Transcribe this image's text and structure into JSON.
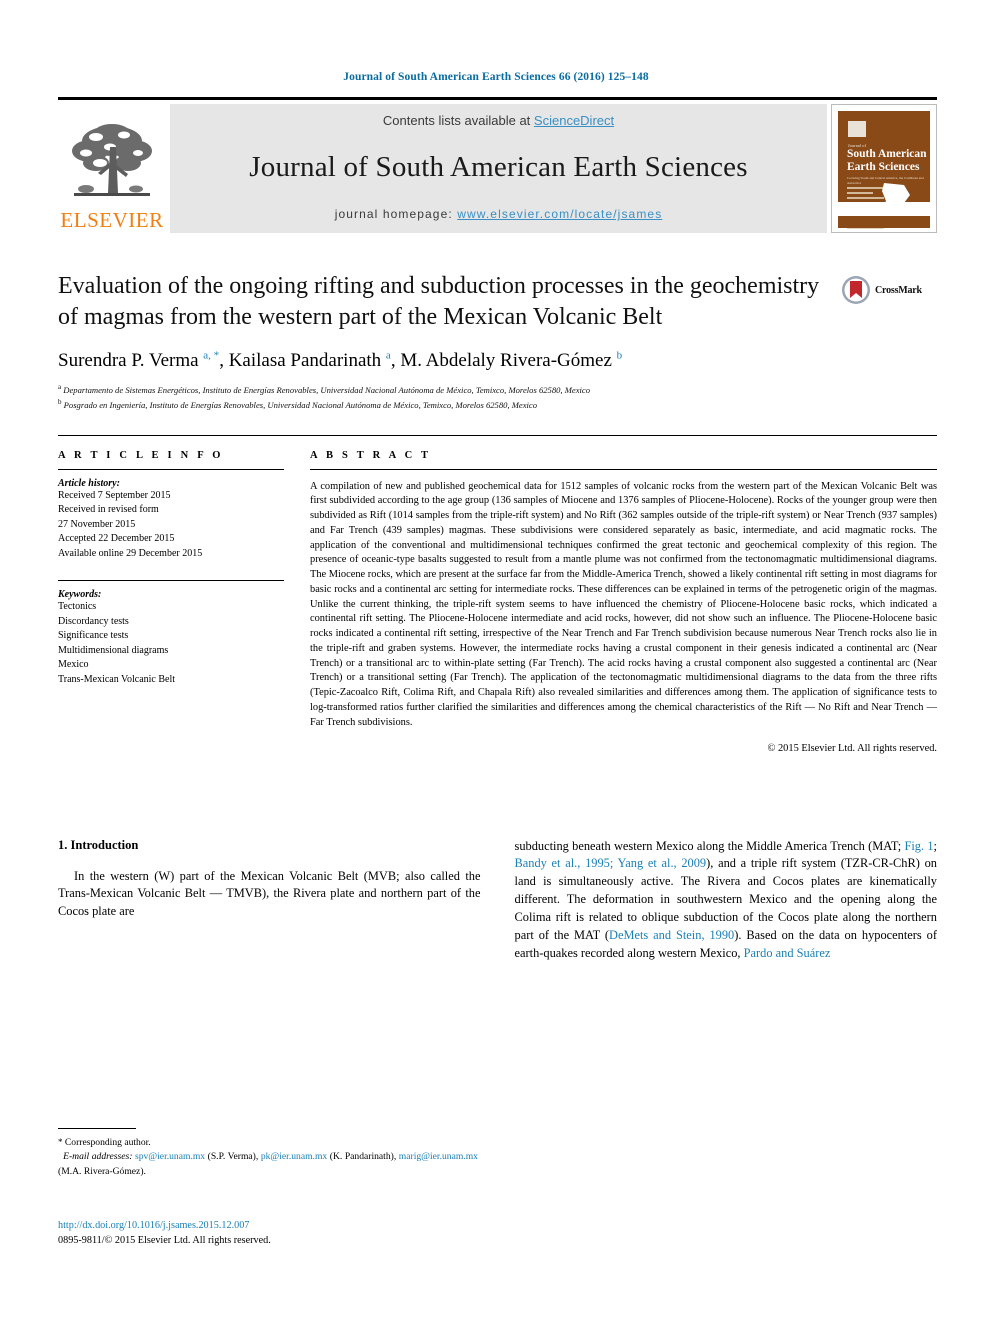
{
  "running_head": "Journal of South American Earth Sciences 66 (2016) 125–148",
  "masthead": {
    "publisher_name": "ELSEVIER",
    "contents_prefix": "Contents lists available at",
    "contents_link": "ScienceDirect",
    "journal_title": "Journal of South American Earth Sciences",
    "homepage_prefix": "journal homepage:",
    "homepage_url": "www.elsevier.com/locate/jsames",
    "cover": {
      "kicker": "Journal of",
      "title_line1": "South American",
      "title_line2": "Earth Sciences",
      "subtitle": "Covering South and Central America, the Caribbean and Antarctica"
    }
  },
  "article": {
    "title": "Evaluation of the ongoing rifting and subduction processes in the geochemistry of magmas from the western part of the Mexican Volcanic Belt",
    "authors_html": "Surendra P. Verma <sup>a, *</sup>, Kailasa Pandarinath <sup>a</sup>, M. Abdelaly Rivera-Gómez <sup>b</sup>",
    "affiliation_a": "Departamento de Sistemas Energéticos, Instituto de Energías Renovables, Universidad Nacional Autónoma de México, Temixco, Morelos 62580, Mexico",
    "affiliation_b": "Posgrado en Ingeniería, Instituto de Energías Renovables, Universidad Nacional Autónoma de México, Temixco, Morelos 62580, Mexico",
    "crossmark_label": "CrossMark"
  },
  "article_info": {
    "heading": "A R T I C L E   I N F O",
    "history_label": "Article history:",
    "history": [
      "Received 7 September 2015",
      "Received in revised form",
      "27 November 2015",
      "Accepted 22 December 2015",
      "Available online 29 December 2015"
    ],
    "keywords_label": "Keywords:",
    "keywords": [
      "Tectonics",
      "Discordancy tests",
      "Significance tests",
      "Multidimensional diagrams",
      "Mexico",
      "Trans-Mexican Volcanic Belt"
    ]
  },
  "abstract": {
    "heading": "A B S T R A C T",
    "text": "A compilation of new and published geochemical data for 1512 samples of volcanic rocks from the western part of the Mexican Volcanic Belt was first subdivided according to the age group (136 samples of Miocene and 1376 samples of Pliocene-Holocene). Rocks of the younger group were then subdivided as Rift (1014 samples from the triple-rift system) and No Rift (362 samples outside of the triple-rift system) or Near Trench (937 samples) and Far Trench (439 samples) magmas. These subdivisions were considered separately as basic, intermediate, and acid magmatic rocks. The application of the conventional and multidimensional techniques confirmed the great tectonic and geochemical complexity of this region. The presence of oceanic-type basalts suggested to result from a mantle plume was not confirmed from the tectonomagmatic multidimensional diagrams. The Miocene rocks, which are present at the surface far from the Middle-America Trench, showed a likely continental rift setting in most diagrams for basic rocks and a continental arc setting for intermediate rocks. These differences can be explained in terms of the petrogenetic origin of the magmas. Unlike the current thinking, the triple-rift system seems to have influenced the chemistry of Pliocene-Holocene basic rocks, which indicated a continental rift setting. The Pliocene-Holocene intermediate and acid rocks, however, did not show such an influence. The Pliocene-Holocene basic rocks indicated a continental rift setting, irrespective of the Near Trench and Far Trench subdivision because numerous Near Trench rocks also lie in the triple-rift and graben systems. However, the intermediate rocks having a crustal component in their genesis indicated a continental arc (Near Trench) or a transitional arc to within-plate setting (Far Trench). The acid rocks having a crustal component also suggested a continental arc (Near Trench) or a transitional setting (Far Trench). The application of the tectonomagmatic multidimensional diagrams to the data from the three rifts (Tepic-Zacoalco Rift, Colima Rift, and Chapala Rift) also revealed similarities and differences among them. The application of significance tests to log-transformed ratios further clarified the similarities and differences among the chemical characteristics of the Rift — No Rift and Near Trench — Far Trench subdivisions.",
    "copyright": "© 2015 Elsevier Ltd. All rights reserved."
  },
  "introduction": {
    "heading": "1. Introduction",
    "left_paragraph": "In the western (W) part of the Mexican Volcanic Belt (MVB; also called the Trans-Mexican Volcanic Belt — TMVB), the Rivera plate and northern part of the Cocos plate are"
  },
  "right_column": {
    "p1": "subducting beneath western Mexico along the Middle America Trench (MAT; ",
    "ref_fig1": "Fig. 1",
    "p2": "; ",
    "ref_bandy": "Bandy et al., 1995; Yang et al., 2009",
    "p3": "), and a triple rift system (TZR-CR-ChR) on land is simultaneously active. The Rivera and Cocos plates are kinematically different. The deformation in southwestern Mexico and the opening along the Colima rift is related to oblique subduction of the Cocos plate along the northern part of the MAT (",
    "ref_demets": "DeMets and Stein, 1990",
    "p4": "). Based on the data on hypocenters of earth-quakes recorded along western Mexico, ",
    "ref_pardo": "Pardo and Suárez"
  },
  "footnotes": {
    "corresponding_star": "*",
    "corresponding": "Corresponding author.",
    "email_label": "E-mail addresses:",
    "email1": "spv@ier.unam.mx",
    "email1_owner": "(S.P. Verma),",
    "email2": "pk@ier.unam.mx",
    "email2_owner": "(K. Pandarinath),",
    "email3": "marig@ier.unam.mx",
    "email3_owner": "(M.A. Rivera-Gómez)."
  },
  "doi_block": {
    "doi_url": "http://dx.doi.org/10.1016/j.jsames.2015.12.007",
    "issn_line": "0895-9811/© 2015 Elsevier Ltd. All rights reserved."
  },
  "colors": {
    "link": "#1a7fb5",
    "sciencedirect": "#3a8fc4",
    "elsevier_orange": "#f07f13",
    "cover_brown": "#8a4a18",
    "masthead_grey": "#e6e6e6"
  }
}
